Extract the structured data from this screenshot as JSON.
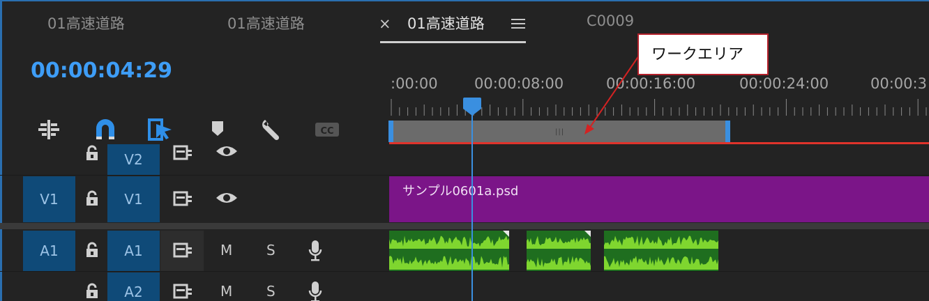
{
  "tabs": [
    {
      "label": "01高速道路",
      "active": false
    },
    {
      "label": "01高速道路",
      "active": false
    },
    {
      "label": "01高速道路",
      "active": true
    },
    {
      "label": "C0009",
      "active": false
    }
  ],
  "close_glyph": "×",
  "timecode": "00:00:04:29",
  "tools": [
    "insert-sequence-icon",
    "snap-magnet-icon",
    "linked-selection-icon",
    "marker-icon",
    "wrench-icon",
    "captions-cc-icon"
  ],
  "cc_label": "CC",
  "ruler_labels": [
    ":00:00",
    "00:00:08:00",
    "00:00:16:00",
    "00:00:24:00",
    "00:00:3"
  ],
  "work_area_grip": "|||",
  "tracks": {
    "v2": {
      "target": "V2"
    },
    "v1": {
      "source": "V1",
      "target": "V1"
    },
    "a1": {
      "source": "A1",
      "target": "A1",
      "mute": "M",
      "solo": "S"
    },
    "a2": {
      "target": "A2",
      "mute": "M",
      "solo": "S"
    }
  },
  "clip_video_name": "サンプル0601a.psd",
  "callout_text": "ワークエリア",
  "colors": {
    "accent_blue": "#3e9df6",
    "video_clip": "#7b1588",
    "audio_clip": "#1f6e1f",
    "work_area_line": "#e0332b",
    "track_button": "#0f4a78"
  }
}
